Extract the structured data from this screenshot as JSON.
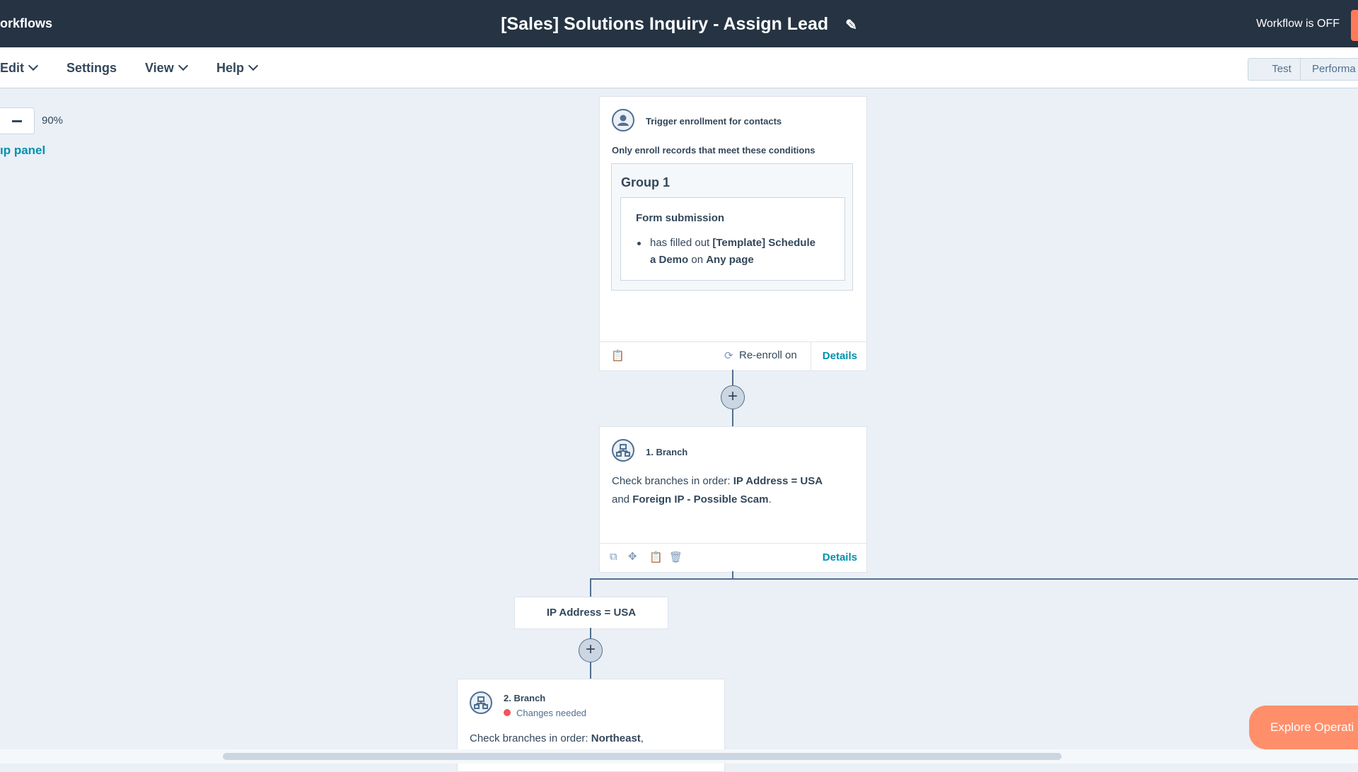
{
  "header": {
    "breadcrumb": "orkflows",
    "title": "[Sales] Solutions Inquiry - Assign Lead",
    "status": "Workflow is OFF"
  },
  "menu": {
    "items": [
      "Edit",
      "Settings",
      "View",
      "Help"
    ],
    "test_label": "Test",
    "performance_label": "Performa"
  },
  "canvas_controls": {
    "zoom_level": "90%",
    "panel_link": "ıp panel"
  },
  "trigger_card": {
    "title": "Trigger enrollment for contacts",
    "subtitle": "Only enroll records that meet these conditions",
    "group_title": "Group 1",
    "condition_title": "Form submission",
    "condition_line1_a": "has filled out ",
    "condition_line1_b": "[Template] Schedule",
    "condition_line2_a": "a Demo",
    "condition_line2_b": " on ",
    "condition_line2_c": "Any page",
    "reenroll": "Re-enroll on",
    "details": "Details"
  },
  "branch1": {
    "title": "1. Branch",
    "text_a": "Check branches in order: ",
    "text_b": "IP Address = USA",
    "text_c": "and ",
    "text_d": "Foreign IP - Possible Scam",
    "text_e": ".",
    "details": "Details"
  },
  "branch_label": "IP Address = USA",
  "branch2": {
    "title": "2. Branch",
    "status": "Changes needed",
    "text_a": "Check branches in order: ",
    "text_b": "Northeast",
    "text_c": ","
  },
  "explore_button": "Explore Operati",
  "colors": {
    "topbar": "#253342",
    "canvas": "#eaf0f6",
    "link": "#0091ae",
    "accent": "#ff7a59",
    "alert": "#f2545b"
  }
}
